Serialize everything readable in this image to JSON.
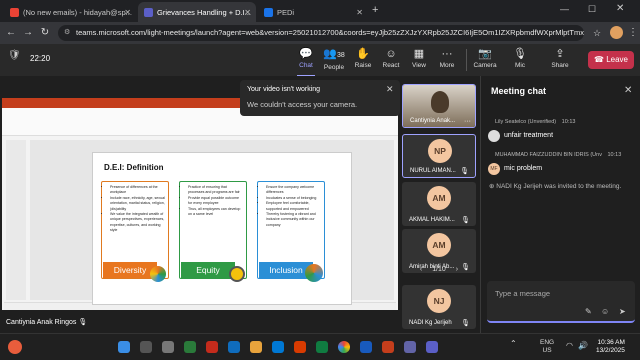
{
  "browser": {
    "tabs": [
      {
        "label": "(No new emails) - hidayah@sp..."
      },
      {
        "label": "Grievances Handling + D.I..."
      },
      {
        "label": "PEDi"
      }
    ],
    "url": "teams.microsoft.com/light-meetings/launch?agent=web&version=25021012700&coords=eyJjb25zZXJzYXRpb25JZCI6IjE5Om1IZXRpbmdfWXprMlptTmxOMl0T..."
  },
  "toolbar": {
    "timer": "22:20",
    "chat": "Chat",
    "people": "People",
    "people_count": "38",
    "raise": "Raise",
    "react": "React",
    "view": "View",
    "more": "More",
    "camera": "Camera",
    "mic": "Mic",
    "share": "Share",
    "leave": "Leave"
  },
  "notice": {
    "title": "Your video isn't working",
    "body": "We couldn't access your camera."
  },
  "slide": {
    "title": "D.E.I: Definition",
    "columns": [
      {
        "label": "Diversity",
        "color": "#e8761f",
        "bullets": [
          "Presence of differences at the workplace",
          "Include race, ethnicity, age, sexual orientation, marital status, religion, (dis)ability",
          "We value the integrated wealth of unique perspectives, experiences, expertise, cultures, and working style"
        ]
      },
      {
        "label": "Equity",
        "color": "#2f9a45",
        "bullets": [
          "Practice of ensuring that processes and programs are fair",
          "Provide equal possible outcome for every employee",
          "Thus, all employees can develop on a same level"
        ]
      },
      {
        "label": "Inclusion",
        "color": "#2b8fd6",
        "bullets": [
          "Ensure the company welcome differences",
          "Inculcates a sense of belonging",
          "Employee feel comfortable, supported and empowered",
          "Thereby fostering a vibrant and inclusive community within our company"
        ]
      }
    ]
  },
  "presenter_name": "Cantiynia Anak Ringos",
  "tiles": [
    {
      "initials": "",
      "name": "Cantiynia Anak...",
      "color": "#7a6a55"
    },
    {
      "initials": "NP",
      "name": "NURUL AIMAN...",
      "color": "#f3c6a0"
    },
    {
      "initials": "AM",
      "name": "AKMAL HAKIM...",
      "color": "#f3c6a0"
    },
    {
      "initials": "AM",
      "name": "Amirah binti Ab...",
      "color": "#f3c6a0"
    },
    {
      "initials": "NJ",
      "name": "NADI Kg Jerijeh",
      "color": "#f3c6a0"
    }
  ],
  "pager": "1/10",
  "chat": {
    "title": "Meeting chat",
    "messages": [
      {
        "author": "Lily Seatelco (Unverified)",
        "time": "10:13",
        "text": "unfair treatment"
      },
      {
        "author": "MUHAMMAD FAIZZUDDIN BIN IDRIS (Unv",
        "time": "10:13",
        "text": "mic problem",
        "initials": "MF"
      },
      {
        "system": "NADI Kg Jerijeh was invited to the meeting."
      }
    ],
    "placeholder": "Type a message"
  },
  "taskbar": {
    "lang": "ENG",
    "region": "US",
    "time": "10:36 AM",
    "date": "13/2/2025"
  }
}
